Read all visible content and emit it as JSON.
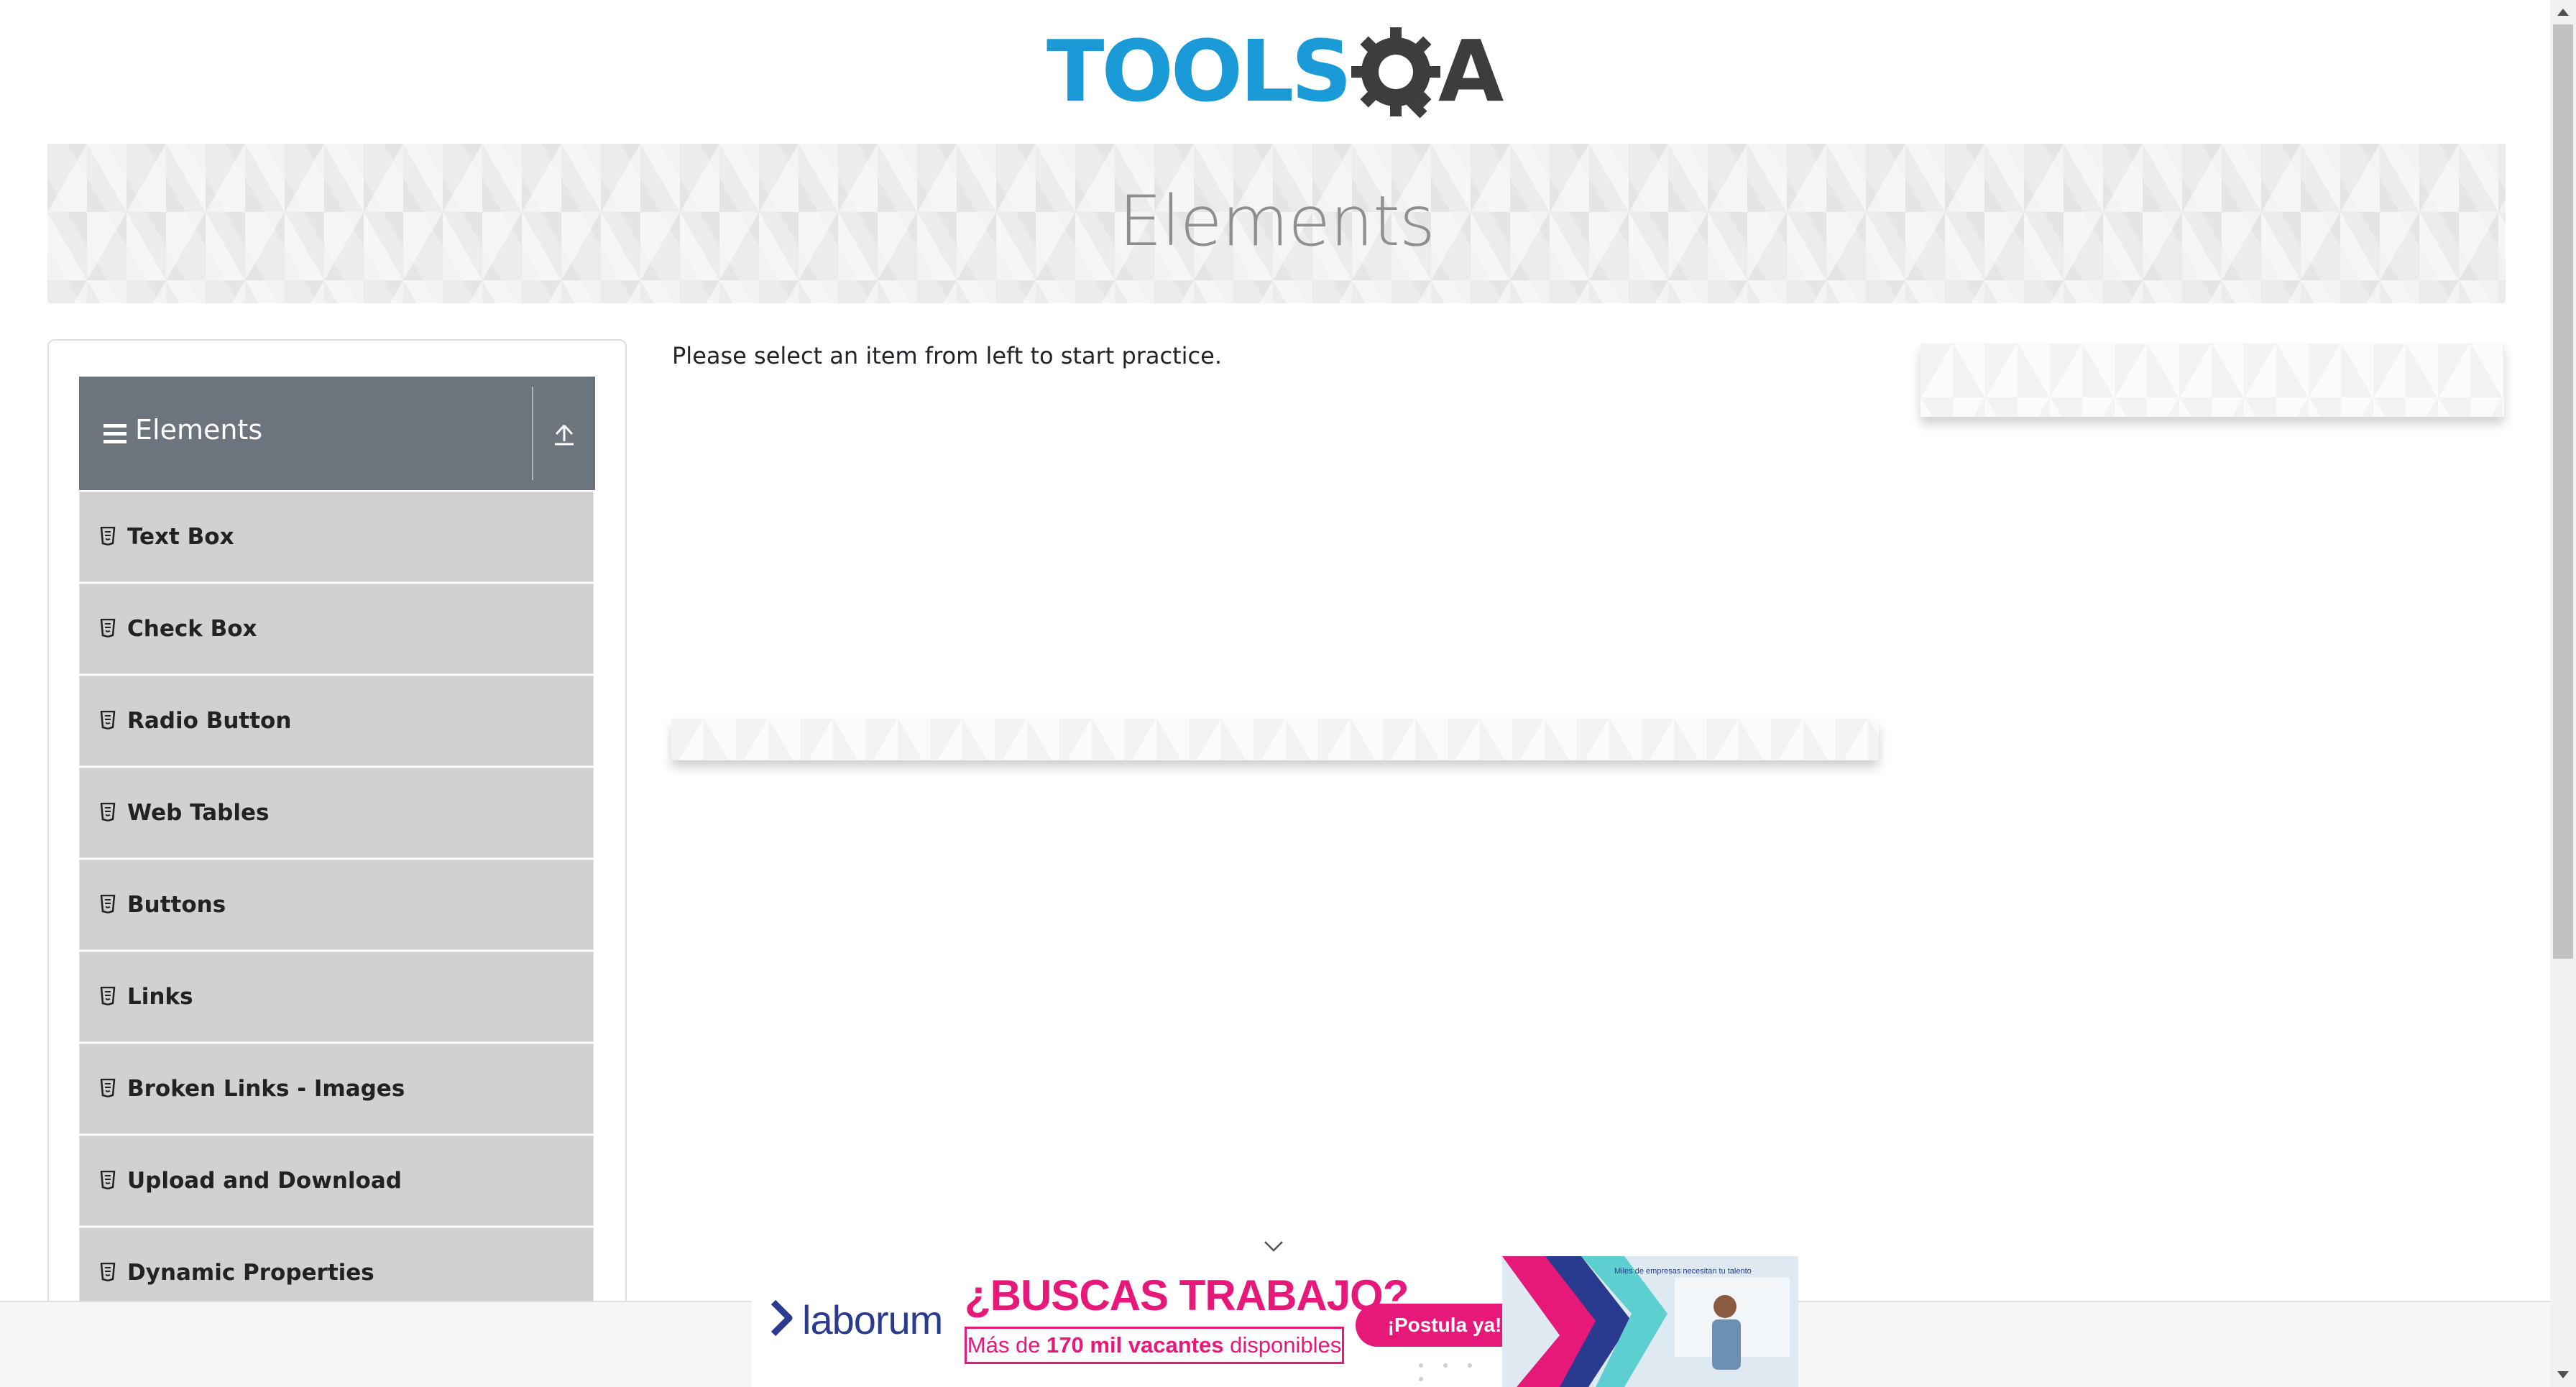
{
  "logo": {
    "part1": "TOOLS",
    "part2": "A",
    "colors": {
      "tools": "#1a9bd7",
      "gear_and_a": "#3d3d3d"
    }
  },
  "banner": {
    "title": "Elements"
  },
  "sidebar": {
    "group": {
      "title": "Elements",
      "icon": "hamburger-icon",
      "action_icon": "collapse-up-icon"
    },
    "items": [
      {
        "label": "Text Box",
        "icon": "document-icon"
      },
      {
        "label": "Check Box",
        "icon": "document-icon"
      },
      {
        "label": "Radio Button",
        "icon": "document-icon"
      },
      {
        "label": "Web Tables",
        "icon": "document-icon"
      },
      {
        "label": "Buttons",
        "icon": "document-icon"
      },
      {
        "label": "Links",
        "icon": "document-icon"
      },
      {
        "label": "Broken Links - Images",
        "icon": "document-icon"
      },
      {
        "label": "Upload and Download",
        "icon": "document-icon"
      },
      {
        "label": "Dynamic Properties",
        "icon": "document-icon"
      }
    ],
    "colors": {
      "header": "#6c757d",
      "item": "#d1d1d1"
    }
  },
  "main": {
    "instruction": "Please select an item from left to start practice."
  },
  "ad": {
    "brand": "laborum",
    "headline": "¿BUSCAS TRABAJO?",
    "subline_prefix": "Más de ",
    "subline_bold": "170 mil vacantes",
    "subline_suffix": " disponibles",
    "cta": "¡Postula ya!",
    "photo_caption": "Miles de empresas necesitan tu talento",
    "collapse_icon": "chevron-down-icon",
    "colors": {
      "accent": "#e6197a",
      "brand": "#2a3b8f"
    }
  }
}
